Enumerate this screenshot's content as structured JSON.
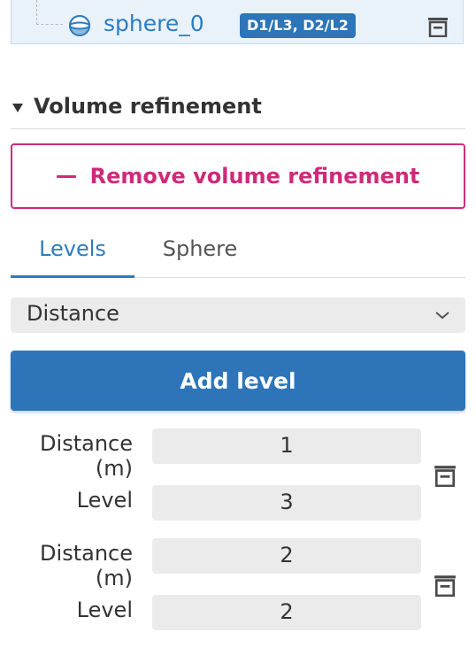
{
  "tree_item": {
    "name": "sphere_0",
    "badge": "D1/L3, D2/L2"
  },
  "section": {
    "title": "Volume refinement",
    "remove_label": "Remove volume refinement"
  },
  "tabs": [
    {
      "label": "Levels",
      "active": true
    },
    {
      "label": "Sphere",
      "active": false
    }
  ],
  "select": {
    "value": "Distance"
  },
  "add_level_label": "Add level",
  "levels": [
    {
      "distance_label_1": "Distance",
      "distance_label_2": "(m)",
      "distance": "1",
      "level_label": "Level",
      "level": "3"
    },
    {
      "distance_label_1": "Distance",
      "distance_label_2": "(m)",
      "distance": "2",
      "level_label": "Level",
      "level": "2"
    }
  ],
  "colors": {
    "accent": "#2d75b8",
    "danger": "#cf2a7a",
    "field_bg": "#ebebeb"
  }
}
